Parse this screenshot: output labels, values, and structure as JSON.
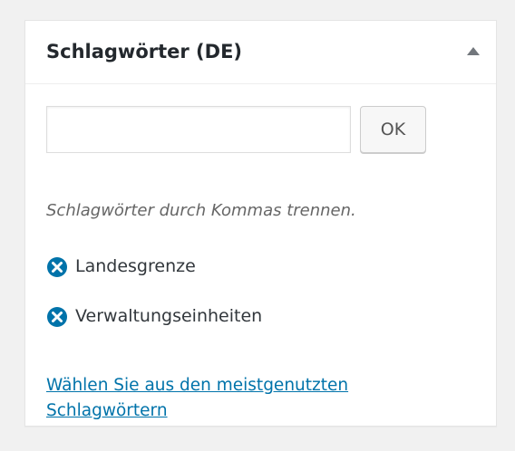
{
  "box": {
    "title": "Schlagwörter (DE)",
    "toggle_icon": "triangle-up-icon"
  },
  "tag_input": {
    "value": "",
    "placeholder": ""
  },
  "add_button": {
    "label": "OK"
  },
  "help_text": "Schlagwörter durch Kommas trennen.",
  "tags": [
    {
      "label": "Landesgrenze",
      "remove_icon": "x-circle-icon"
    },
    {
      "label": "Verwaltungseinheiten",
      "remove_icon": "x-circle-icon"
    }
  ],
  "most_used_link": "Wählen Sie aus den meistgenutzten Schlagwörtern",
  "colors": {
    "link": "#0073aa",
    "remove_icon": "#0073aa",
    "toggle_icon": "#72777c",
    "page_background": "#f1f1f1",
    "box_border": "#e5e5e5"
  }
}
